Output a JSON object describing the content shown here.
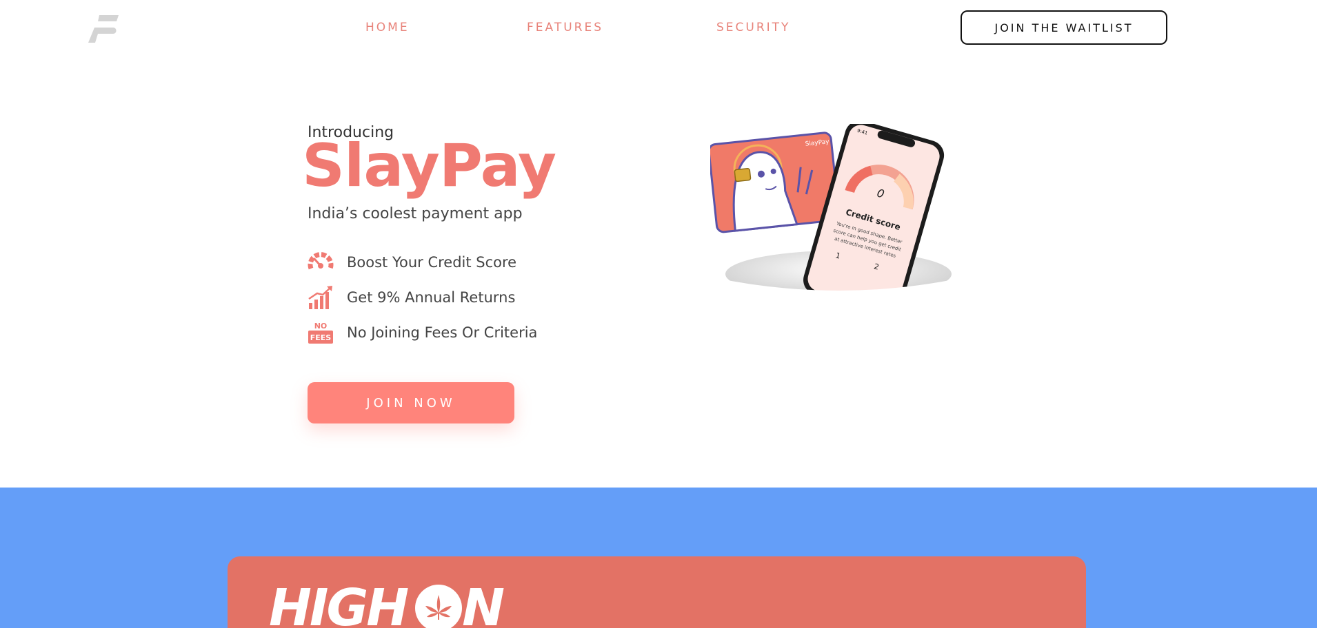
{
  "nav": {
    "logo_icon": "slaypay-logo-icon",
    "links": [
      {
        "label": "HOME"
      },
      {
        "label": "FEATURES"
      },
      {
        "label": "SECURITY"
      }
    ],
    "cta_label": "JOIN THE WAITLIST"
  },
  "hero": {
    "intro": "Introducing",
    "brand_part1": "Slay",
    "brand_part2": "Pay",
    "tagline": "India’s coolest payment app",
    "features": [
      {
        "icon": "speedometer-icon",
        "label": "Boost Your Credit Score"
      },
      {
        "icon": "growth-chart-icon",
        "label": "Get 9% Annual Returns"
      },
      {
        "icon": "no-fees-icon",
        "label": "No Joining Fees Or Criteria",
        "icon_text_top": "NO",
        "icon_text_bottom": "FEES"
      }
    ],
    "cta_label": "JOIN NOW"
  },
  "illustration": {
    "card_brand": "SlayPay",
    "phone_time": "9:41",
    "score_value": "0",
    "score_title": "Credit score",
    "score_desc_1": "You're in good shape. Better",
    "score_desc_2": "score can help you get credit",
    "score_desc_3": "at attractive interest rates",
    "stat_1": "1",
    "stat_2": "2"
  },
  "promo": {
    "title_part1": "HIGH ",
    "title_part2": "N"
  },
  "colors": {
    "accent": "#f07a72",
    "button": "#ff847b",
    "band": "#649ef8",
    "promo_card": "#e37265"
  }
}
